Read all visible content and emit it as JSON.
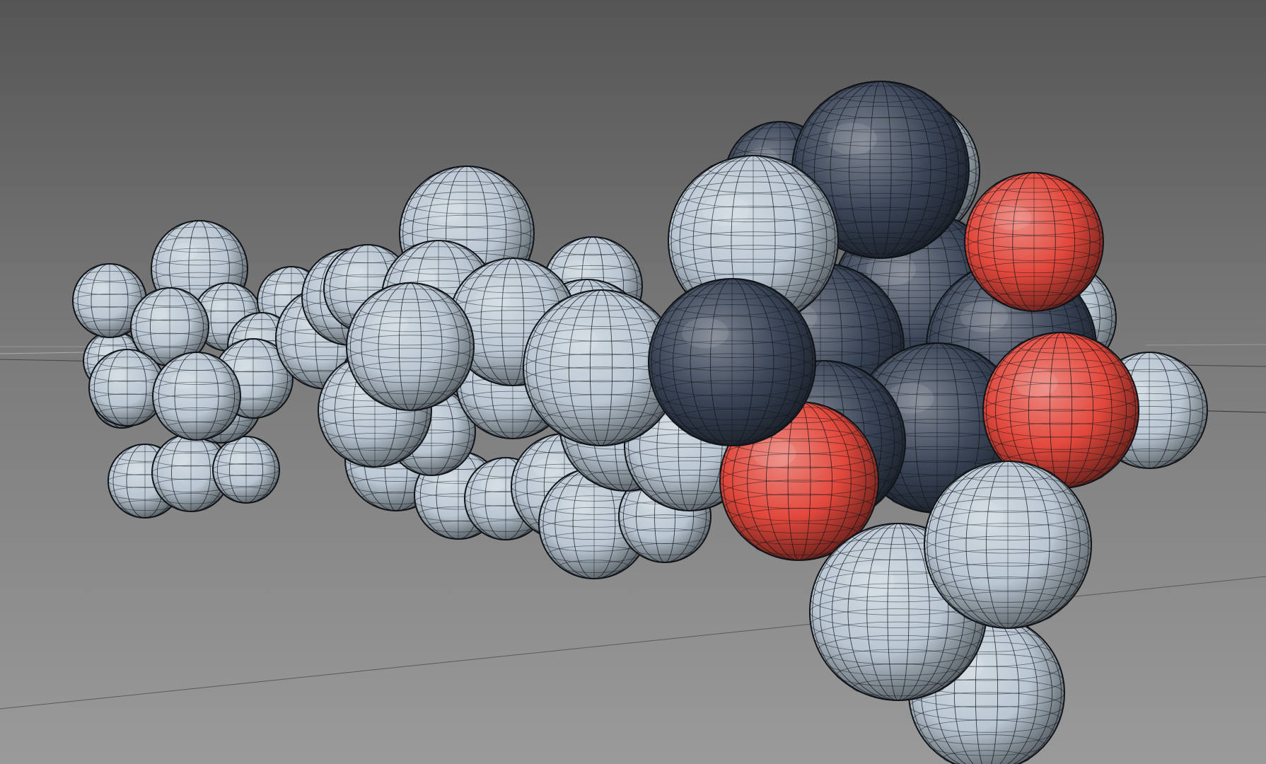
{
  "viewport": {
    "background_top": "#555555",
    "background_bottom": "#9a9a9a",
    "view": "perspective"
  },
  "model": {
    "type": "space-filling molecule",
    "render_style": "wireframe over shaded spheres",
    "atom_colors": {
      "hydrogen": "#b9c7d3",
      "carbon": "#3a4558",
      "oxygen": "#e2483c"
    },
    "atom_counts": {
      "hydrogen": 46,
      "carbon": 11,
      "oxygen": 4
    }
  },
  "grid": {
    "visible": true
  }
}
